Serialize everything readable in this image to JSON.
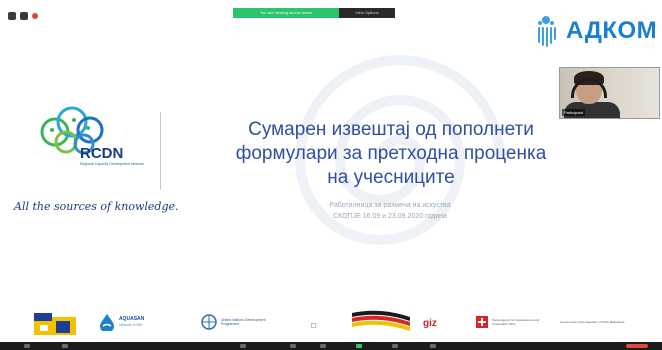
{
  "share_bar": {
    "status": "You are viewing screen share",
    "options": "View Options"
  },
  "brand": {
    "name": "АДКОМ",
    "color": "#1b7fd1"
  },
  "webcam": {
    "participant_name": "Participant"
  },
  "rcdn": {
    "title": "RCDN",
    "subtitle": "Regional Capacity Development Network",
    "tagline": "All the sources of knowledge."
  },
  "slide": {
    "title_line1": "Сумарен извештај од пополнети",
    "title_line2": "формулари за претходна проценка",
    "title_line3": "на учесниците",
    "subtitle_line1": "Работилница за размена на искуства",
    "subtitle_line2": "СКОПЈЕ 16.09 и 23.09.2020 година",
    "title_color": "#2f4fa5"
  },
  "partners": {
    "aquasan_name": "AQUASAN",
    "aquasan_sub": "Network in BiH",
    "un_text": "United Nations Development Programme",
    "giz_text": "giz",
    "ch_text": "Swiss Agency for Development and Cooperation SDC",
    "mk_text": "Government of the Republic of North Macedonia"
  },
  "toolbar": {
    "icons": [
      "mute-icon",
      "video-icon",
      "security-icon",
      "participants-icon",
      "chat-icon",
      "share-screen-icon",
      "record-icon",
      "reactions-icon",
      "leave-button"
    ]
  }
}
